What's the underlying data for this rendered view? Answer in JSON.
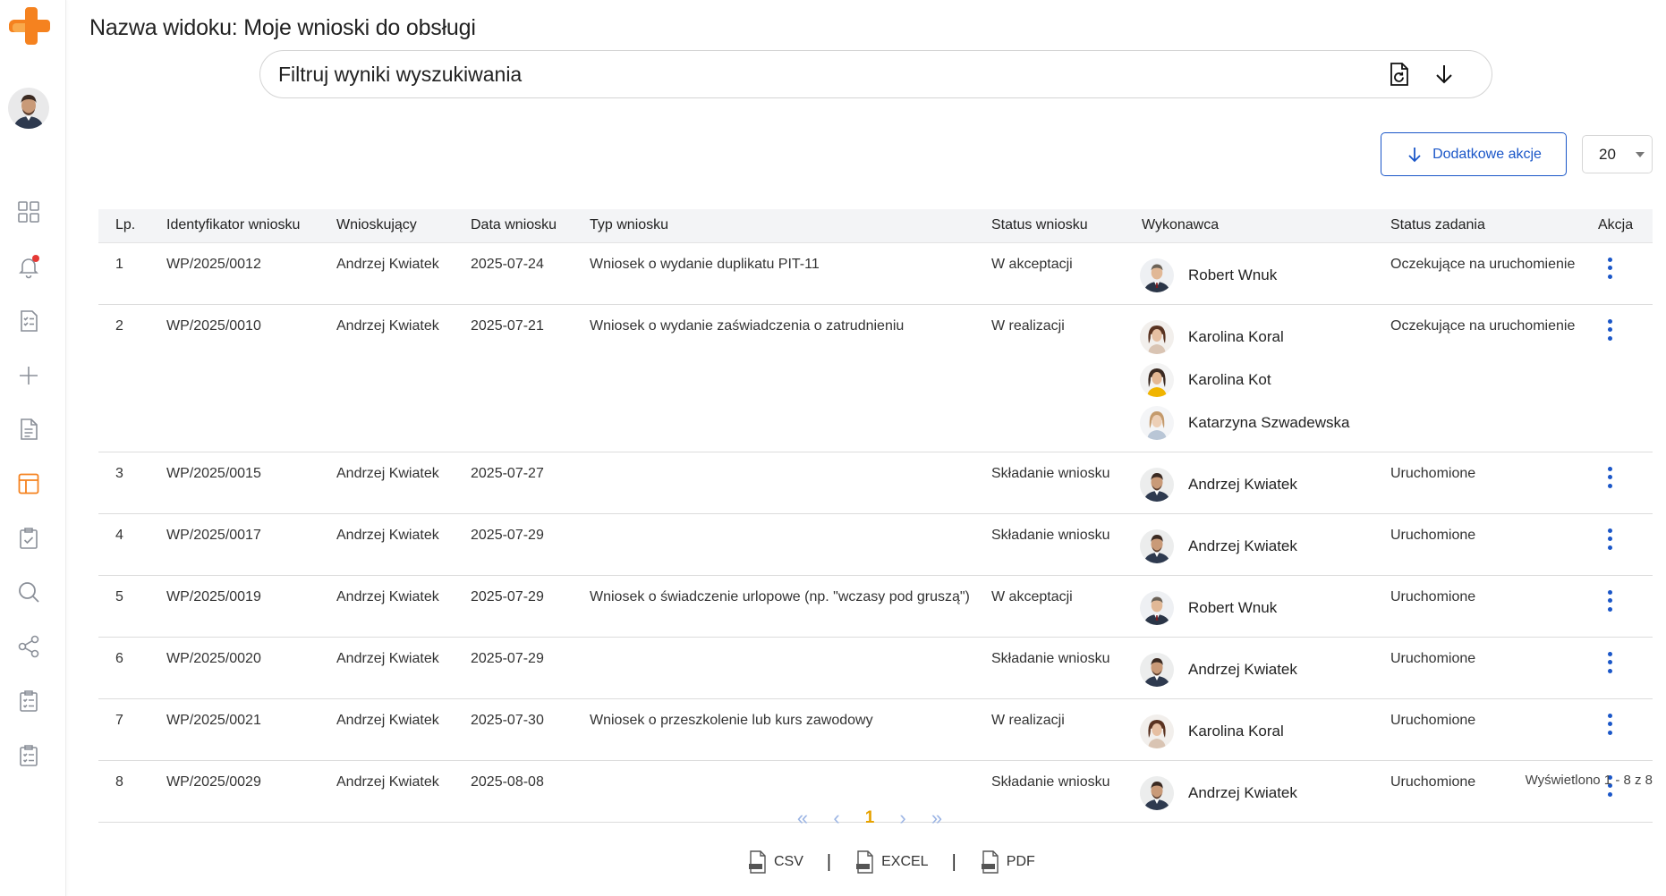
{
  "sidebar": {
    "logo_icon": "orange-cross-logo",
    "user_avatar": "user-avatar",
    "icons": [
      "dashboard-grid-icon",
      "bell-icon",
      "checklist-icon",
      "plus-icon",
      "document-icon",
      "layout-panel-icon",
      "clipboard-check-icon",
      "search-icon",
      "share-icon",
      "task-list-icon",
      "task-list-alt-icon"
    ],
    "notification_dot_color": "#e53935",
    "active_color": "#f5821f"
  },
  "page": {
    "title": "Nazwa widoku: Moje wnioski do obsługi"
  },
  "filter": {
    "label": "Filtruj wyniki wyszukiwania"
  },
  "toolbar": {
    "actions_label": "Dodatkowe akcje",
    "page_size": "20"
  },
  "table": {
    "headers": {
      "lp": "Lp.",
      "id": "Identyfikator wniosku",
      "requester": "Wnioskujący",
      "date": "Data wniosku",
      "type": "Typ wniosku",
      "status": "Status wniosku",
      "executor": "Wykonawca",
      "task_status": "Status zadania",
      "action": "Akcja"
    },
    "rows": [
      {
        "lp": "1",
        "id": "WP/2025/0012",
        "requester": "Andrzej Kwiatek",
        "date": "2025-07-24",
        "type": "Wniosek o wydanie duplikatu PIT-11",
        "status": "W akceptacji",
        "executors": [
          "Robert Wnuk"
        ],
        "task_status": "Oczekujące na uruchomienie"
      },
      {
        "lp": "2",
        "id": "WP/2025/0010",
        "requester": "Andrzej Kwiatek",
        "date": "2025-07-21",
        "type": "Wniosek o wydanie zaświadczenia o zatrudnieniu",
        "status": "W realizacji",
        "executors": [
          "Karolina Koral",
          "Karolina Kot",
          "Katarzyna Szwadewska"
        ],
        "task_status": "Oczekujące na uruchomienie"
      },
      {
        "lp": "3",
        "id": "WP/2025/0015",
        "requester": "Andrzej Kwiatek",
        "date": "2025-07-27",
        "type": "",
        "status": "Składanie wniosku",
        "executors": [
          "Andrzej Kwiatek"
        ],
        "task_status": "Uruchomione"
      },
      {
        "lp": "4",
        "id": "WP/2025/0017",
        "requester": "Andrzej Kwiatek",
        "date": "2025-07-29",
        "type": "",
        "status": "Składanie wniosku",
        "executors": [
          "Andrzej Kwiatek"
        ],
        "task_status": "Uruchomione"
      },
      {
        "lp": "5",
        "id": "WP/2025/0019",
        "requester": "Andrzej Kwiatek",
        "date": "2025-07-29",
        "type": "Wniosek o świadczenie urlopowe (np. \"wczasy pod gruszą\")",
        "status": "W akceptacji",
        "executors": [
          "Robert Wnuk"
        ],
        "task_status": "Uruchomione"
      },
      {
        "lp": "6",
        "id": "WP/2025/0020",
        "requester": "Andrzej Kwiatek",
        "date": "2025-07-29",
        "type": "",
        "status": "Składanie wniosku",
        "executors": [
          "Andrzej Kwiatek"
        ],
        "task_status": "Uruchomione"
      },
      {
        "lp": "7",
        "id": "WP/2025/0021",
        "requester": "Andrzej Kwiatek",
        "date": "2025-07-30",
        "type": "Wniosek o przeszkolenie lub kurs zawodowy",
        "status": "W realizacji",
        "executors": [
          "Karolina Koral"
        ],
        "task_status": "Uruchomione"
      },
      {
        "lp": "8",
        "id": "WP/2025/0029",
        "requester": "Andrzej Kwiatek",
        "date": "2025-08-08",
        "type": "",
        "status": "Składanie wniosku",
        "executors": [
          "Andrzej Kwiatek"
        ],
        "task_status": "Uruchomione"
      }
    ]
  },
  "summary": "Wyświetlono 1 - 8 z 8",
  "pagination": {
    "first": "«",
    "prev": "‹",
    "current": "1",
    "next": "›",
    "last": "»"
  },
  "exports": {
    "csv": "CSV",
    "excel": "EXCEL",
    "pdf": "PDF",
    "separator": "|"
  },
  "colors": {
    "accent_blue": "#1a56c8",
    "accent_orange": "#f5821f",
    "pagination_current": "#e6a200"
  }
}
